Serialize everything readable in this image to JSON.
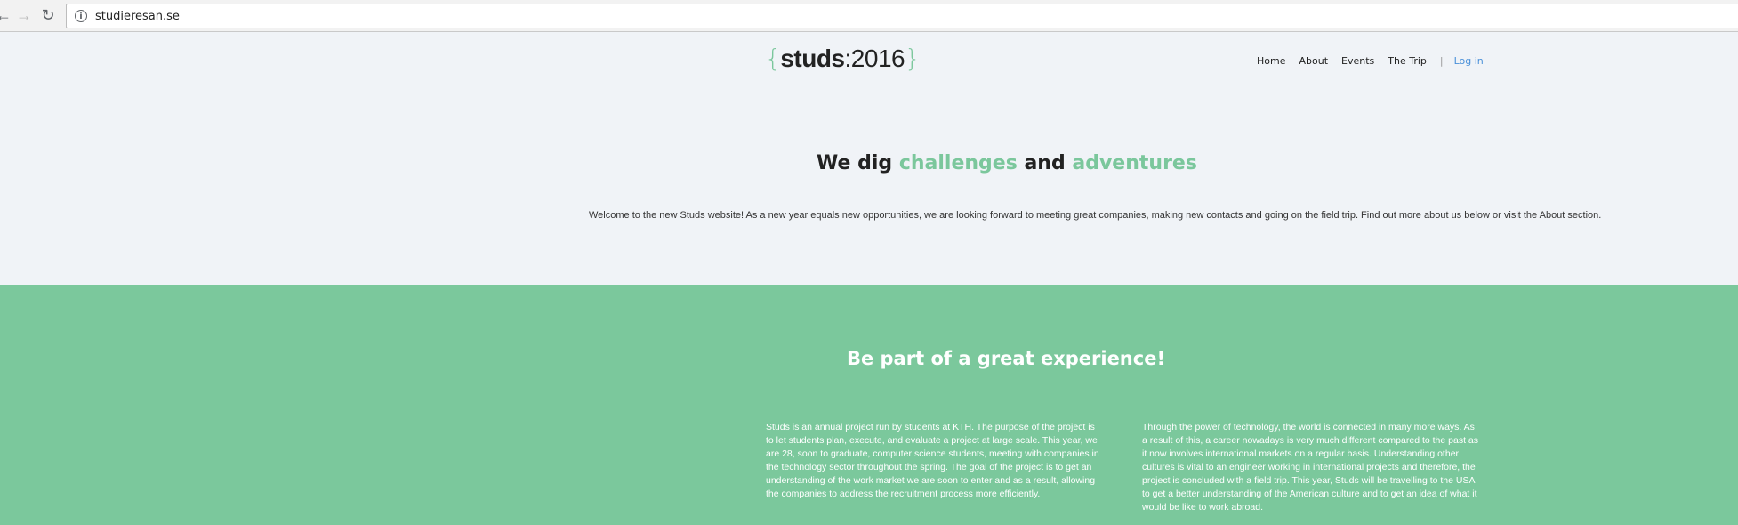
{
  "browser": {
    "url": "studieresan.se",
    "icons": [
      "back-arrow-icon",
      "forward-arrow-icon",
      "reload-icon",
      "info-icon"
    ]
  },
  "site": {
    "logo": {
      "open_brace": "{",
      "studs": "studs",
      "colon": ":",
      "year": "2016",
      "close_brace": "}"
    },
    "nav": {
      "home": "Home",
      "about": "About",
      "events": "Events",
      "trip": "The Trip",
      "separator": "|",
      "login": "Log in"
    }
  },
  "hero": {
    "heading_pre": "We dig ",
    "heading_accent1": "challenges",
    "heading_mid": " and ",
    "heading_accent2": "adventures",
    "text": "Welcome to the new Studs website! As a new year equals new opportunities, we are looking forward to meeting great companies, making new contacts and going on the field trip. Find out more about us below or visit the About section."
  },
  "experience": {
    "heading": "Be part of a great experience!",
    "left": "Studs is an annual project run by students at KTH. The purpose of the project is to let students plan, execute, and evaluate a project at large scale. This year, we are 28, soon to graduate, computer science students, meeting with companies in the technology sector throughout the spring. The goal of the project is to get an understanding of the work market we are soon to enter and as a result, allowing the companies to address the recruitment process more efficiently.",
    "right": "Through the power of technology, the world is connected in many more ways. As a result of this, a career nowadays is very much different compared to the past as it now involves international markets on a regular basis. Understanding other cultures is vital to an engineer working in international projects and therefore, the project is concluded with a field trip. This year, Studs will be travelling to the USA to get a better understanding of the American culture and to get an idea of what it would be like to work abroad."
  },
  "colors": {
    "accent": "#7bc79c",
    "green_section": "#7bc89c",
    "page_bg": "#f0f3f7",
    "login_link": "#4a90d9"
  }
}
